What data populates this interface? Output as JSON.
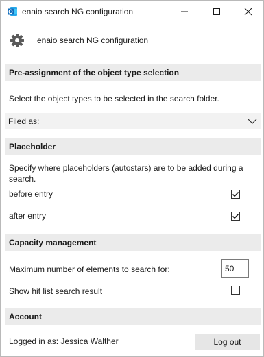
{
  "window": {
    "title": "enaio search NG configuration",
    "app_icon": "outlook-icon"
  },
  "header": {
    "icon": "gear-icon",
    "title": "enaio search NG configuration"
  },
  "preassignment": {
    "heading": "Pre-assignment of the object type selection",
    "description": "Select the object types to be selected in the search folder.",
    "dropdown_label": "Filed as:"
  },
  "placeholder": {
    "heading": "Placeholder",
    "description": "Specify where placeholders (autostars) are to be added during a search.",
    "before_label": "before entry",
    "before_checked": true,
    "after_label": "after entry",
    "after_checked": true
  },
  "capacity": {
    "heading": "Capacity management",
    "max_label": "Maximum number of elements to search for:",
    "max_value": "50",
    "show_hit_label": "Show hit list search result",
    "show_hit_checked": false
  },
  "account": {
    "heading": "Account",
    "logged_in_label": "Logged in as: Jessica Walther",
    "logout_label": "Log out"
  }
}
